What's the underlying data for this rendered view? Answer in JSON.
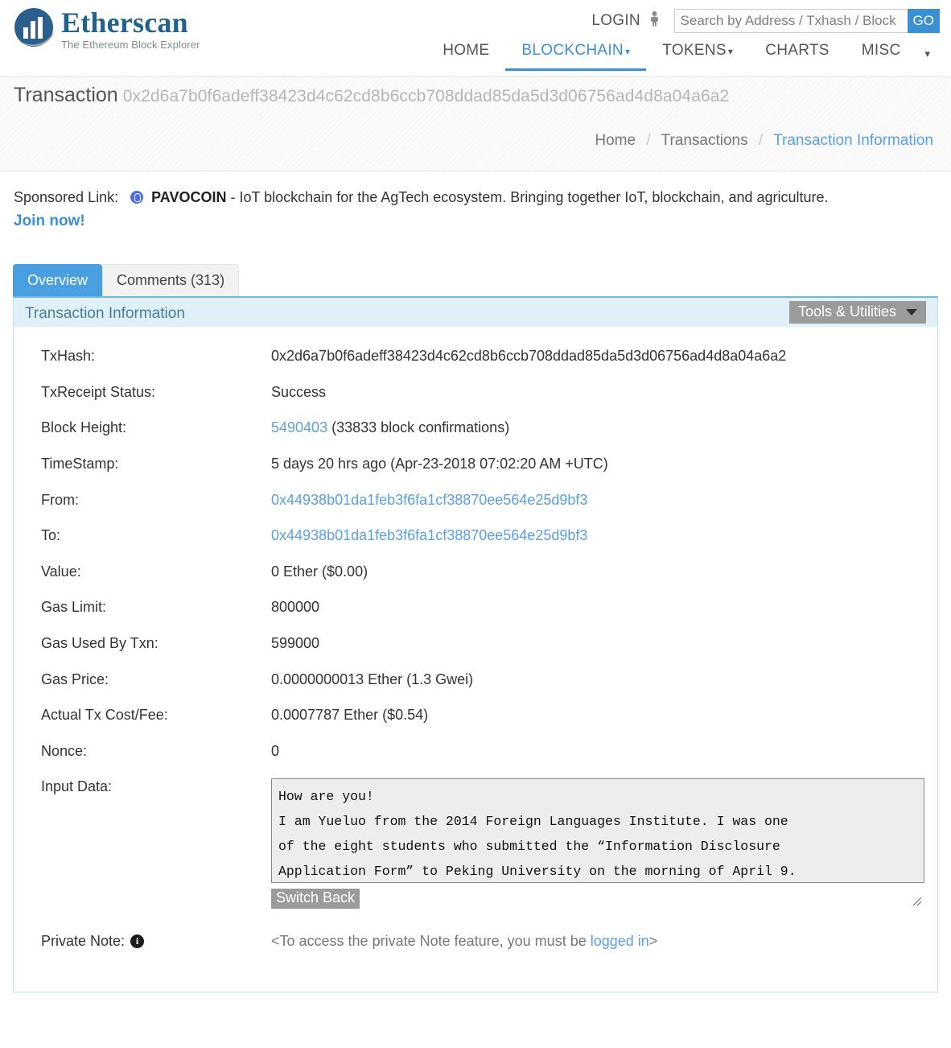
{
  "brand": {
    "name": "Etherscan",
    "tagline": "The Ethereum Block Explorer",
    "logo_icon": "etherscan-bars-logo",
    "primary_color": "#21618c",
    "accent_color": "#3b8fd4"
  },
  "header": {
    "login_label": "LOGIN",
    "login_icon": "person-icon",
    "search_placeholder": "Search by Address / Txhash / Block",
    "search_value": "",
    "go_label": "GO",
    "nav": [
      {
        "label": "HOME",
        "active": false,
        "has_caret": false
      },
      {
        "label": "BLOCKCHAIN",
        "active": true,
        "has_caret": true
      },
      {
        "label": "TOKENS",
        "active": false,
        "has_caret": true
      },
      {
        "label": "CHARTS",
        "active": false,
        "has_caret": false
      },
      {
        "label": "MISC",
        "active": false,
        "has_caret": false
      }
    ],
    "nav_more_icon": "chevron-down-icon"
  },
  "subheader": {
    "title": "Transaction",
    "hash": "0x2d6a7b0f6adeff38423d4c62cd8b6ccb708ddad85da5d3d06756ad4d8a04a6a2",
    "breadcrumb": {
      "home": "Home",
      "transactions": "Transactions",
      "current": "Transaction Information",
      "separator": "/"
    }
  },
  "sponsored": {
    "label": "Sponsored Link:",
    "icon": "pavocoin-icon",
    "brand": "PAVOCOIN",
    "text": " - IoT blockchain for the AgTech ecosystem. Bringing together IoT, blockchain, and agriculture.",
    "cta": "Join now!"
  },
  "tabs": [
    {
      "label": "Overview",
      "active": true
    },
    {
      "label": "Comments (313)",
      "active": false
    }
  ],
  "card": {
    "title": "Transaction Information",
    "tools_label": "Tools & Utilities",
    "tools_caret_icon": "triangle-down-icon"
  },
  "transaction": {
    "rows": [
      {
        "label": "TxHash:",
        "value": "0x2d6a7b0f6adeff38423d4c62cd8b6ccb708ddad85da5d3d06756ad4d8a04a6a2",
        "style": "plain"
      },
      {
        "label": "TxReceipt Status:",
        "value": "Success",
        "style": "success"
      },
      {
        "label": "Block Height:",
        "value": "5490403",
        "suffix": " (33833 block confirmations)",
        "style": "link"
      },
      {
        "label": "TimeStamp:",
        "value": "5 days 20 hrs ago (Apr-23-2018 07:02:20 AM +UTC)",
        "style": "plain"
      },
      {
        "label": "From:",
        "value": "0x44938b01da1feb3f6fa1cf38870ee564e25d9bf3",
        "style": "link"
      },
      {
        "label": "To:",
        "value": "0x44938b01da1feb3f6fa1cf38870ee564e25d9bf3",
        "style": "link"
      },
      {
        "label": "Value:",
        "value": "0 Ether ($0.00)",
        "style": "plain"
      },
      {
        "label": "Gas Limit:",
        "value": "800000",
        "style": "plain"
      },
      {
        "label": "Gas Used By Txn:",
        "value": "599000",
        "style": "plain"
      },
      {
        "label": "Gas Price:",
        "value": "0.0000000013 Ether (1.3 Gwei)",
        "style": "plain"
      },
      {
        "label": "Actual Tx Cost/Fee:",
        "value": "0.0007787 Ether ($0.54)",
        "style": "plain"
      },
      {
        "label": "Nonce:",
        "value": "0",
        "style": "plain"
      }
    ],
    "input_data": {
      "label": "Input Data:",
      "text": "How are you!\nI am Yueluo from the 2014 Foreign Languages Institute. I was one\nof the eight students who submitted the “Information Disclosure\nApplication Form” to Peking University on the morning of April 9.\nI also need to block and note this text to illustrate more of",
      "switch_label": "Switch Back"
    },
    "private_note": {
      "label": "Private Note:",
      "info_icon": "info-icon",
      "text_before": "<To access the private Note feature, you must be ",
      "link": "logged in",
      "text_after": ">"
    }
  }
}
